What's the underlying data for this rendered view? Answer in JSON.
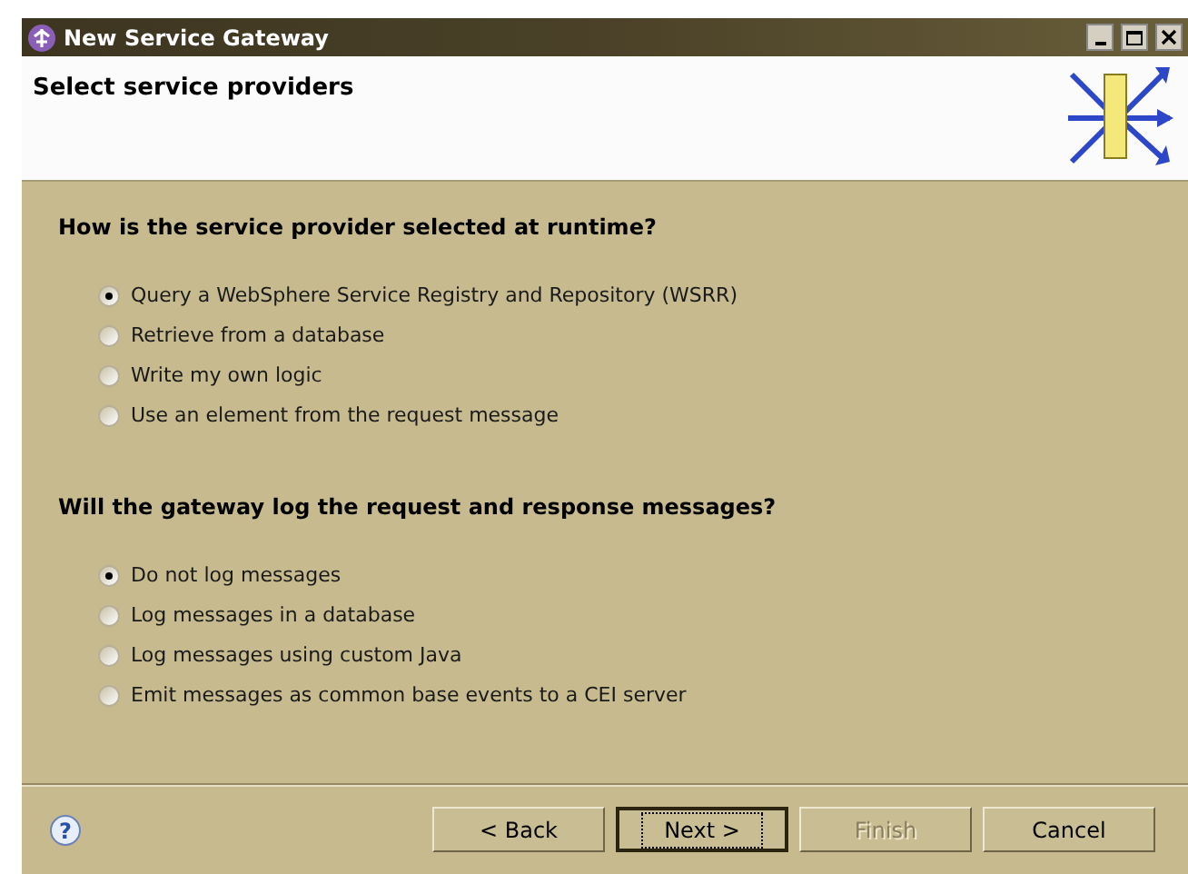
{
  "window": {
    "title": "New Service Gateway"
  },
  "header": {
    "title": "Select service providers"
  },
  "groups": [
    {
      "question": "How is the service provider selected at runtime?",
      "options": [
        {
          "label": "Query a WebSphere Service Registry and Repository (WSRR)",
          "selected": true
        },
        {
          "label": "Retrieve from a database",
          "selected": false
        },
        {
          "label": "Write my own logic",
          "selected": false
        },
        {
          "label": "Use an element from the request message",
          "selected": false
        }
      ]
    },
    {
      "question": "Will the gateway log the request and response messages?",
      "options": [
        {
          "label": "Do not log messages",
          "selected": true
        },
        {
          "label": "Log messages in a database",
          "selected": false
        },
        {
          "label": "Log messages using custom Java",
          "selected": false
        },
        {
          "label": "Emit messages as common base events to a CEI server",
          "selected": false
        }
      ]
    }
  ],
  "help": {
    "glyph": "?"
  },
  "buttons": [
    {
      "label": "< Back",
      "disabled": false,
      "default": false
    },
    {
      "label": "Next >",
      "disabled": false,
      "default": true
    },
    {
      "label": "Finish",
      "disabled": true,
      "default": false
    },
    {
      "label": "Cancel",
      "disabled": false,
      "default": false
    }
  ]
}
